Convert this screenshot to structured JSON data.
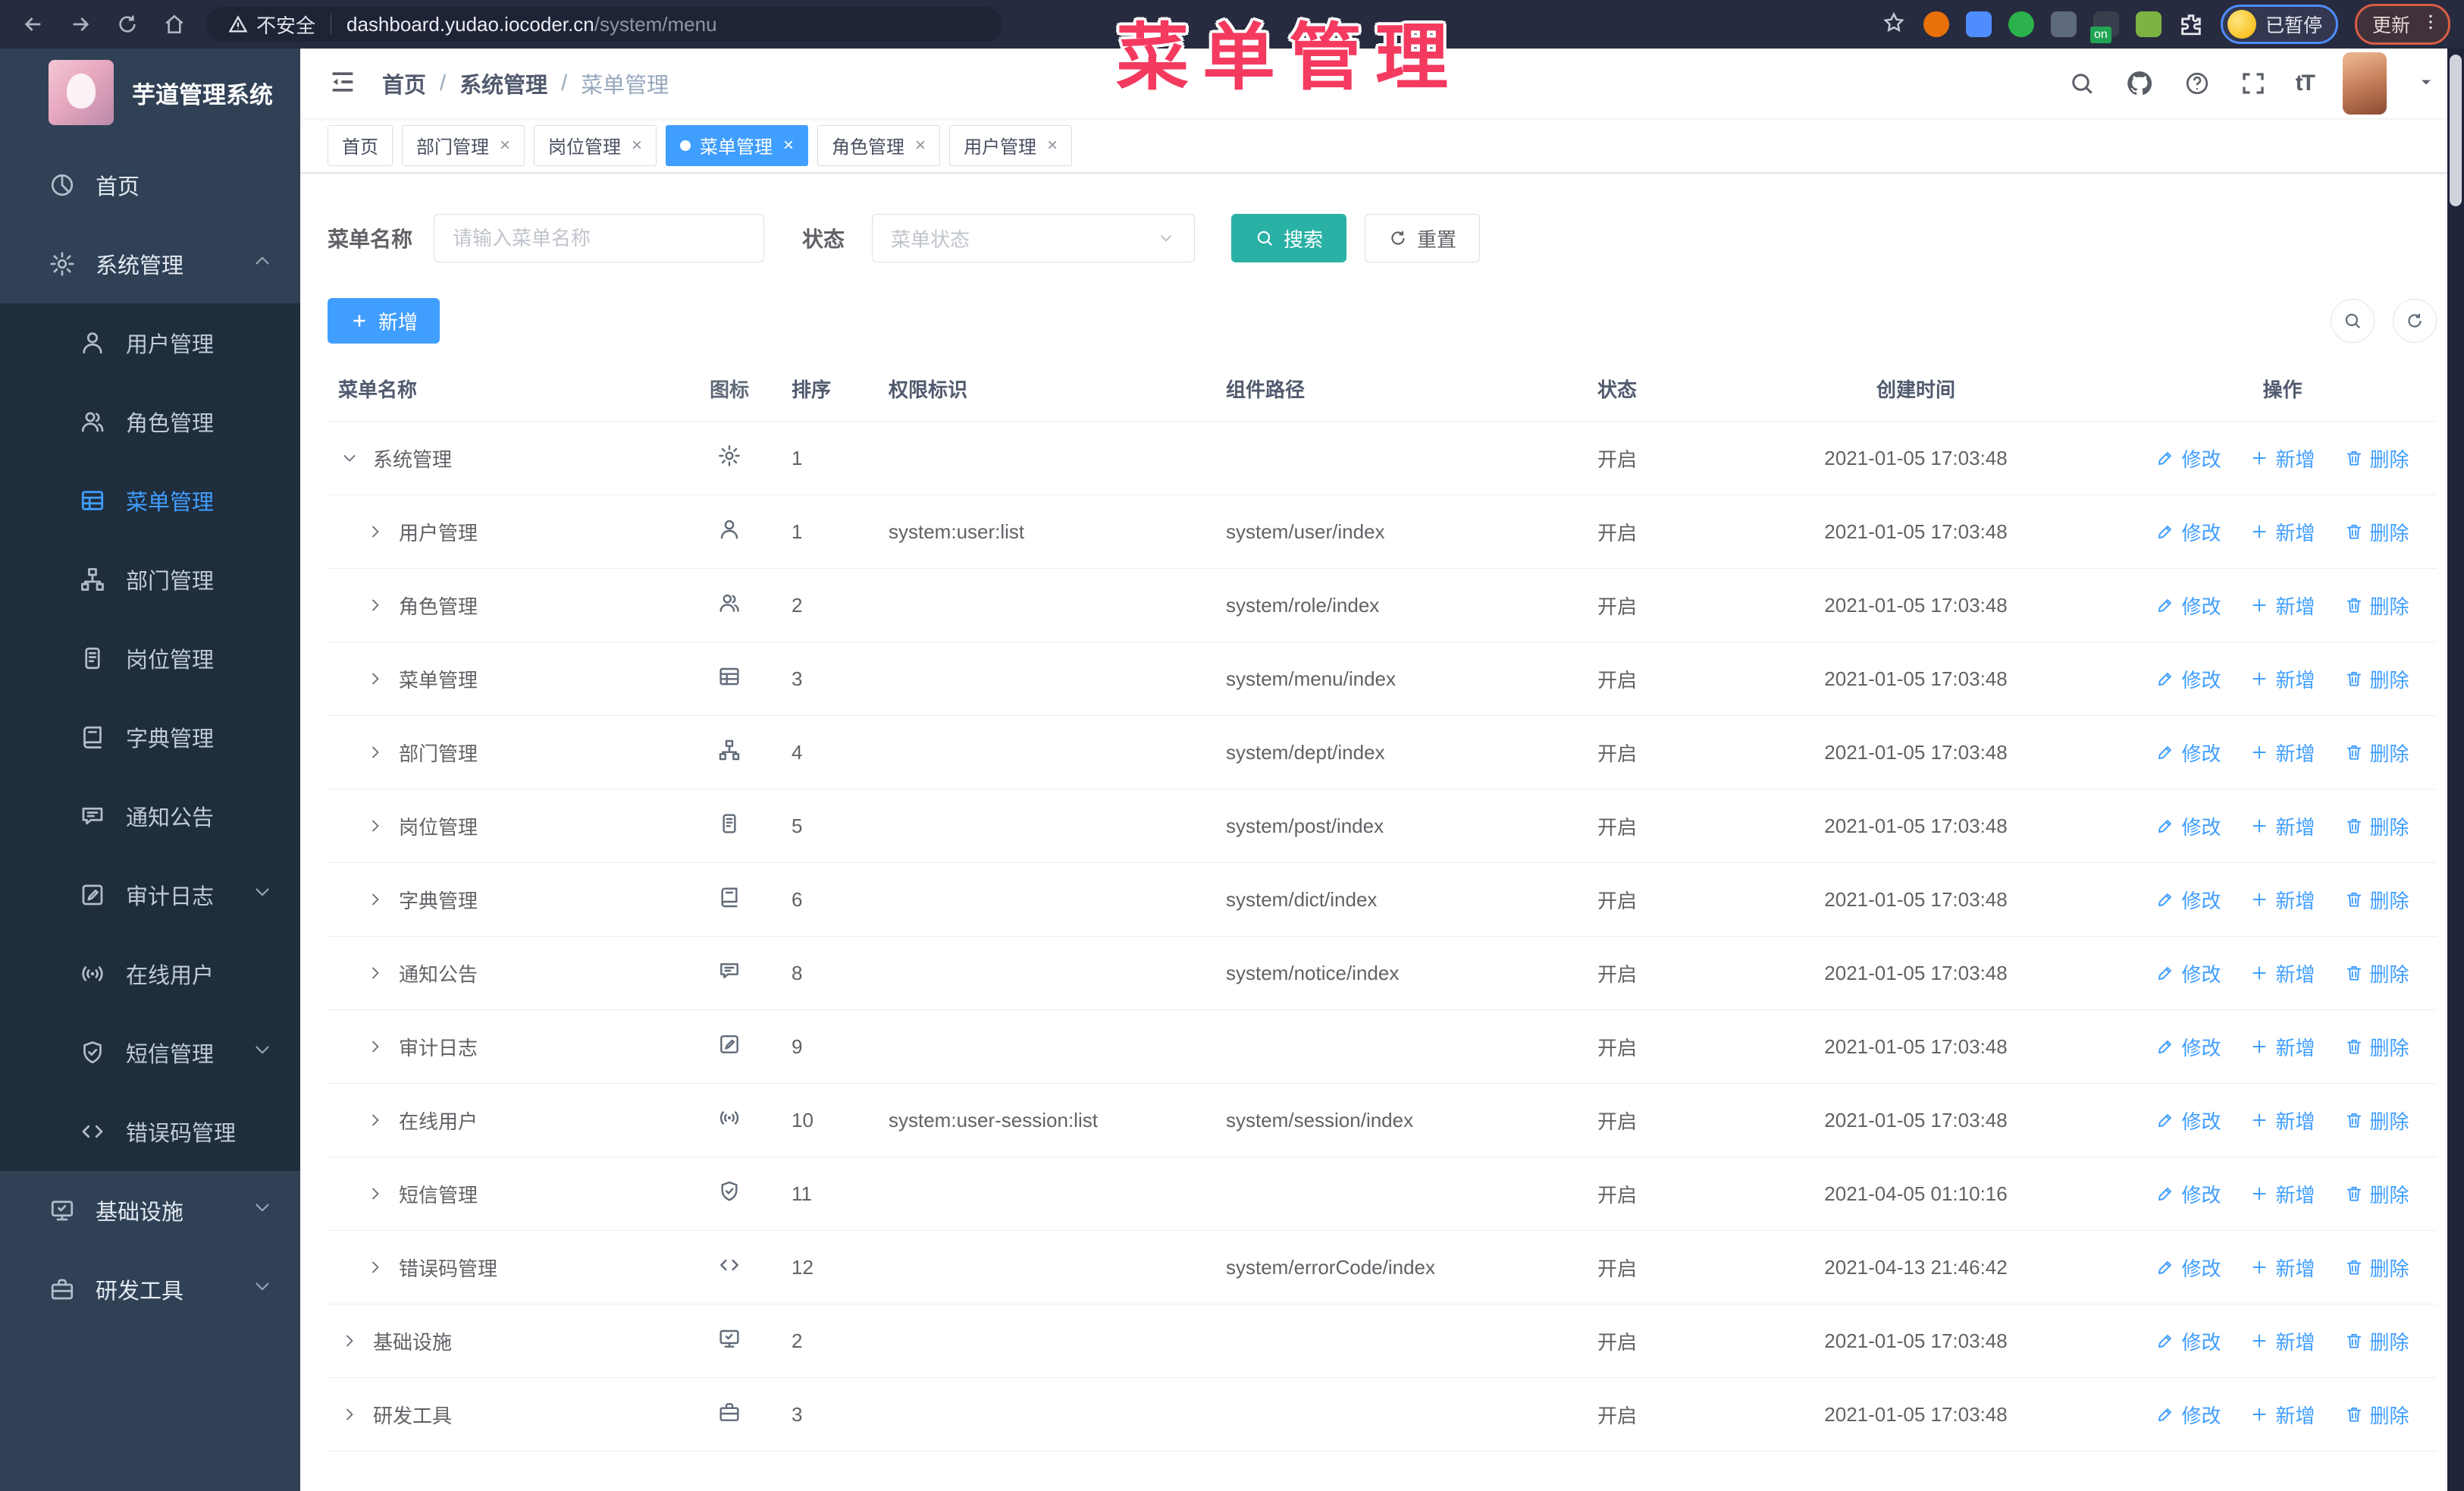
{
  "browser": {
    "security_label": "不安全",
    "url_host": "dashboard.yudao.iocoder.cn",
    "url_path": "/system/menu",
    "profile_badge": "已暂停",
    "update_label": "更新",
    "extensions": [
      {
        "name": "ext-orange-icon",
        "color": "#e8710a",
        "shape": "round"
      },
      {
        "name": "ext-blue-gem-icon",
        "color": "#4e8cff",
        "shape": "square"
      },
      {
        "name": "ext-green-check-icon",
        "color": "#2bb24c",
        "shape": "round"
      },
      {
        "name": "ext-gray-blue-icon",
        "color": "#5f6b7c",
        "shape": "square"
      },
      {
        "name": "ext-dark-on-icon",
        "color": "#3a3f4d",
        "shape": "square",
        "badge": "on"
      },
      {
        "name": "ext-android-icon",
        "color": "#7cb342",
        "shape": "square"
      },
      {
        "name": "ext-puzzle-icon",
        "color": "#e8eaed",
        "shape": "puzzle"
      }
    ]
  },
  "annotation": {
    "text": "菜单管理"
  },
  "sidebar": {
    "title": "芋道管理系统",
    "items": [
      {
        "label": "首页",
        "icon": "dashboard-icon",
        "type": "top"
      },
      {
        "label": "系统管理",
        "icon": "gear-icon",
        "type": "top",
        "chevron": "up"
      },
      {
        "label": "用户管理",
        "icon": "user-icon",
        "type": "sub"
      },
      {
        "label": "角色管理",
        "icon": "users-icon",
        "type": "sub"
      },
      {
        "label": "菜单管理",
        "icon": "menu-tree-icon",
        "type": "sub",
        "active": true
      },
      {
        "label": "部门管理",
        "icon": "org-tree-icon",
        "type": "sub"
      },
      {
        "label": "岗位管理",
        "icon": "badge-icon",
        "type": "sub"
      },
      {
        "label": "字典管理",
        "icon": "dict-icon",
        "type": "sub"
      },
      {
        "label": "通知公告",
        "icon": "notice-icon",
        "type": "sub"
      },
      {
        "label": "审计日志",
        "icon": "log-icon",
        "type": "sub",
        "chevron": "down"
      },
      {
        "label": "在线用户",
        "icon": "online-icon",
        "type": "sub"
      },
      {
        "label": "短信管理",
        "icon": "sms-shield-icon",
        "type": "sub",
        "chevron": "down"
      },
      {
        "label": "错误码管理",
        "icon": "code-icon",
        "type": "sub"
      },
      {
        "label": "基础设施",
        "icon": "infra-icon",
        "type": "top",
        "chevron": "down"
      },
      {
        "label": "研发工具",
        "icon": "tools-icon",
        "type": "top",
        "chevron": "down"
      }
    ]
  },
  "navbar": {
    "breadcrumb": [
      "首页",
      "系统管理",
      "菜单管理"
    ]
  },
  "tabs": [
    {
      "label": "首页",
      "closable": false,
      "active": false
    },
    {
      "label": "部门管理",
      "closable": true,
      "active": false
    },
    {
      "label": "岗位管理",
      "closable": true,
      "active": false
    },
    {
      "label": "菜单管理",
      "closable": true,
      "active": true
    },
    {
      "label": "角色管理",
      "closable": true,
      "active": false
    },
    {
      "label": "用户管理",
      "closable": true,
      "active": false
    }
  ],
  "filters": {
    "name_label": "菜单名称",
    "name_placeholder": "请输入菜单名称",
    "status_label": "状态",
    "status_placeholder": "菜单状态",
    "search_label": "搜索",
    "reset_label": "重置"
  },
  "toolbar": {
    "add_label": "新增"
  },
  "table": {
    "columns": [
      "菜单名称",
      "图标",
      "排序",
      "权限标识",
      "组件路径",
      "状态",
      "创建时间",
      "操作"
    ],
    "action_labels": {
      "edit": "修改",
      "add": "新增",
      "delete": "删除"
    },
    "rows": [
      {
        "name": "系统管理",
        "icon": "gear-icon",
        "level": 0,
        "expanded": true,
        "sort": "1",
        "perm": "",
        "path": "",
        "status": "开启",
        "time": "2021-01-05 17:03:48"
      },
      {
        "name": "用户管理",
        "icon": "user-icon",
        "level": 1,
        "expanded": false,
        "sort": "1",
        "perm": "system:user:list",
        "path": "system/user/index",
        "status": "开启",
        "time": "2021-01-05 17:03:48"
      },
      {
        "name": "角色管理",
        "icon": "users-icon",
        "level": 1,
        "expanded": false,
        "sort": "2",
        "perm": "",
        "path": "system/role/index",
        "status": "开启",
        "time": "2021-01-05 17:03:48"
      },
      {
        "name": "菜单管理",
        "icon": "menu-tree-icon",
        "level": 1,
        "expanded": false,
        "sort": "3",
        "perm": "",
        "path": "system/menu/index",
        "status": "开启",
        "time": "2021-01-05 17:03:48"
      },
      {
        "name": "部门管理",
        "icon": "org-tree-icon",
        "level": 1,
        "expanded": false,
        "sort": "4",
        "perm": "",
        "path": "system/dept/index",
        "status": "开启",
        "time": "2021-01-05 17:03:48"
      },
      {
        "name": "岗位管理",
        "icon": "badge-icon",
        "level": 1,
        "expanded": false,
        "sort": "5",
        "perm": "",
        "path": "system/post/index",
        "status": "开启",
        "time": "2021-01-05 17:03:48"
      },
      {
        "name": "字典管理",
        "icon": "dict-icon",
        "level": 1,
        "expanded": false,
        "sort": "6",
        "perm": "",
        "path": "system/dict/index",
        "status": "开启",
        "time": "2021-01-05 17:03:48"
      },
      {
        "name": "通知公告",
        "icon": "notice-icon",
        "level": 1,
        "expanded": false,
        "sort": "8",
        "perm": "",
        "path": "system/notice/index",
        "status": "开启",
        "time": "2021-01-05 17:03:48"
      },
      {
        "name": "审计日志",
        "icon": "log-icon",
        "level": 1,
        "expanded": false,
        "sort": "9",
        "perm": "",
        "path": "",
        "status": "开启",
        "time": "2021-01-05 17:03:48"
      },
      {
        "name": "在线用户",
        "icon": "online-icon",
        "level": 1,
        "expanded": false,
        "sort": "10",
        "perm": "system:user-session:list",
        "path": "system/session/index",
        "status": "开启",
        "time": "2021-01-05 17:03:48"
      },
      {
        "name": "短信管理",
        "icon": "sms-shield-icon",
        "level": 1,
        "expanded": false,
        "sort": "11",
        "perm": "",
        "path": "",
        "status": "开启",
        "time": "2021-04-05 01:10:16"
      },
      {
        "name": "错误码管理",
        "icon": "code-icon",
        "level": 1,
        "expanded": false,
        "sort": "12",
        "perm": "",
        "path": "system/errorCode/index",
        "status": "开启",
        "time": "2021-04-13 21:46:42"
      },
      {
        "name": "基础设施",
        "icon": "infra-icon",
        "level": 0,
        "expanded": false,
        "sort": "2",
        "perm": "",
        "path": "",
        "status": "开启",
        "time": "2021-01-05 17:03:48"
      },
      {
        "name": "研发工具",
        "icon": "tools-icon",
        "level": 0,
        "expanded": false,
        "sort": "3",
        "perm": "",
        "path": "",
        "status": "开启",
        "time": "2021-01-05 17:03:48"
      }
    ]
  },
  "colors": {
    "accent": "#409eff",
    "teal": "#2ab1a5",
    "sidebar_bg": "#304156",
    "submenu_bg": "#1f2d3d",
    "annotation_pink": "#f43a5f"
  }
}
